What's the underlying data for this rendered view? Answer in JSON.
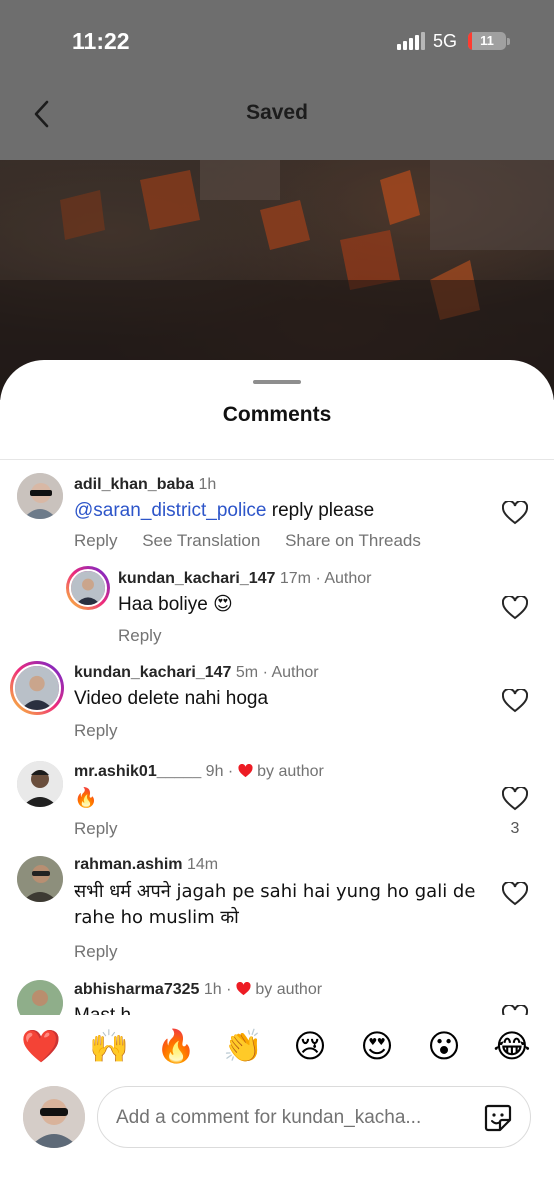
{
  "status_bar": {
    "time": "11:22",
    "network": "5G",
    "battery": "11",
    "battery_level": 0.11
  },
  "header": {
    "title": "Saved"
  },
  "sheet": {
    "title": "Comments"
  },
  "comments": [
    {
      "username": "adil_khan_baba",
      "time": "1h",
      "mention": "@saran_district_police",
      "text": " reply please",
      "actions": [
        "Reply",
        "See Translation",
        "Share on Threads"
      ]
    },
    {
      "username": "kundan_kachari_147",
      "time": "17m",
      "badge": "· Author",
      "text": "Haa boliye 😍",
      "actions": [
        "Reply"
      ]
    },
    {
      "username": "kundan_kachari_147",
      "time": "5m",
      "badge": "· Author",
      "text": "Video delete nahi hoga",
      "actions": [
        "Reply"
      ]
    },
    {
      "username": "mr.ashik01_____",
      "time": "9h",
      "badge": "· ",
      "badge2": "by author",
      "text": "🔥",
      "actions": [
        "Reply"
      ],
      "likes": "3"
    },
    {
      "username": "rahman.ashim",
      "time": "14m",
      "text": "सभी धर्म अपने jagah pe sahi hai yung ho gali de rahe ho muslim को",
      "actions": [
        "Reply"
      ]
    },
    {
      "username": "abhisharma7325",
      "time": "1h",
      "badge": "· ",
      "badge2": "by author",
      "text": "Mast h",
      "actions": []
    }
  ],
  "reactions": [
    "❤️",
    "🙌",
    "🔥",
    "👏",
    "😢",
    "😍",
    "😮",
    "😂"
  ],
  "composer": {
    "placeholder": "Add a comment for kundan_kacha..."
  },
  "colors": {
    "mention": "#2d55c9",
    "heart_red": "#ed1c24",
    "header_bg": "#6e6e6e"
  }
}
